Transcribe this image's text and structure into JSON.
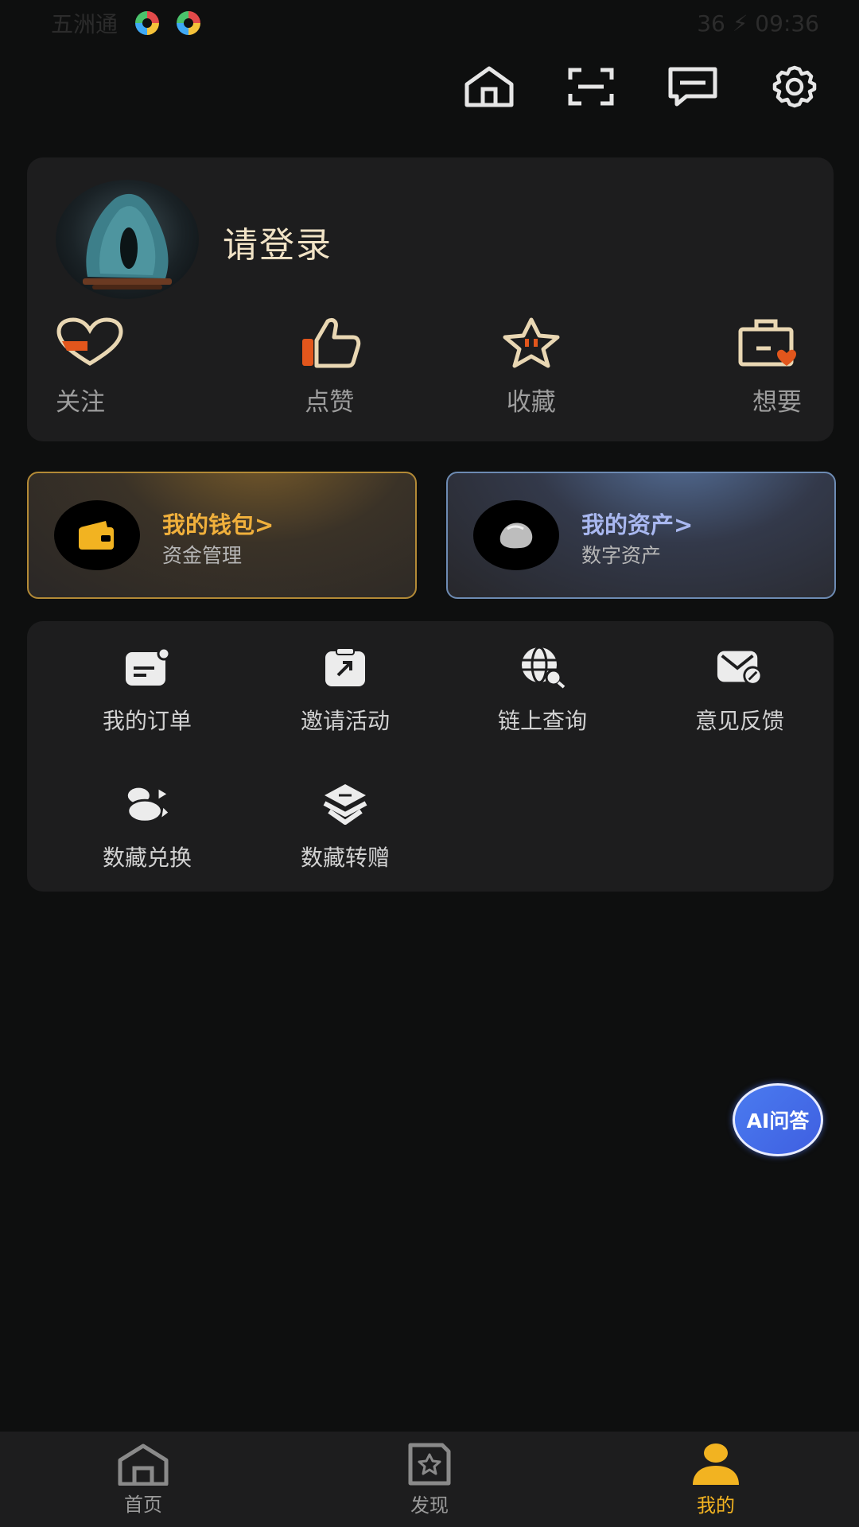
{
  "status_bar": {
    "left_text": "五洲通",
    "right_text": "36 ⚡ 09:36"
  },
  "top_toolbar": {
    "icons": [
      "home-icon",
      "scan-icon",
      "message-icon",
      "settings-icon"
    ]
  },
  "profile": {
    "login_text": "请登录",
    "stats": [
      {
        "label": "关注",
        "icon": "heart-icon"
      },
      {
        "label": "点赞",
        "icon": "thumbs-up-icon"
      },
      {
        "label": "收藏",
        "icon": "star-icon"
      },
      {
        "label": "想要",
        "icon": "briefcase-heart-icon"
      }
    ]
  },
  "wallet": {
    "title": "我的钱包>",
    "subtitle": "资金管理"
  },
  "assets": {
    "title": "我的资产>",
    "subtitle": "数字资产"
  },
  "services": [
    {
      "label": "我的订单",
      "icon": "order-icon"
    },
    {
      "label": "邀请活动",
      "icon": "invite-icon"
    },
    {
      "label": "链上查询",
      "icon": "chain-search-icon"
    },
    {
      "label": "意见反馈",
      "icon": "feedback-icon"
    },
    {
      "label": "数藏兑换",
      "icon": "exchange-icon"
    },
    {
      "label": "数藏转赠",
      "icon": "transfer-icon"
    }
  ],
  "ai_button": {
    "label": "AI问答"
  },
  "bottom_nav": [
    {
      "label": "首页",
      "icon": "home-icon",
      "active": false
    },
    {
      "label": "发现",
      "icon": "discover-icon",
      "active": false
    },
    {
      "label": "我的",
      "icon": "profile-icon",
      "active": true
    }
  ],
  "colors": {
    "background": "#0e0f0f",
    "card": "#1d1d1e",
    "accent_gold": "#f2b321",
    "accent_blue": "#a9b8f0"
  }
}
